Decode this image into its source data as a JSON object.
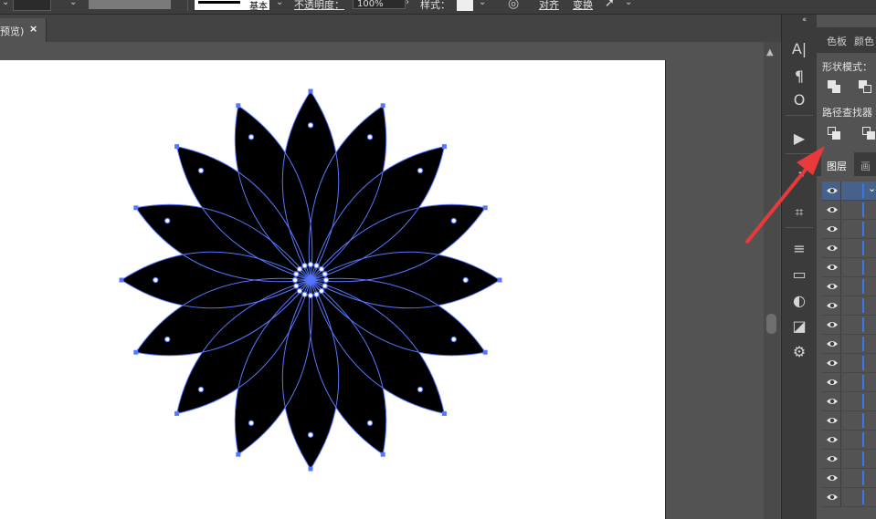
{
  "control_bar": {
    "basic_label": "基本",
    "opacity_label": "不透明度：",
    "opacity_value": "100%",
    "style_label": "样式：",
    "align_label": "对齐",
    "transform_label": "变换"
  },
  "document_tab": {
    "title": "预览)",
    "close_glyph": "×"
  },
  "dock": {
    "collapse_glyph": "‹‹",
    "tools": [
      {
        "name": "character-icon",
        "glyph": "A|"
      },
      {
        "name": "paragraph-icon",
        "glyph": "¶"
      },
      {
        "name": "opentype-icon",
        "glyph": "O"
      },
      {
        "name": "actions-play-icon",
        "glyph": "▶"
      },
      {
        "name": "export-icon",
        "glyph": "↗"
      },
      {
        "name": "artboards-icon",
        "glyph": "⌗"
      },
      {
        "name": "stroke-icon",
        "glyph": "≡"
      },
      {
        "name": "gradient-icon",
        "glyph": "▭"
      },
      {
        "name": "transparency-icon",
        "glyph": "◐"
      },
      {
        "name": "symbols-icon",
        "glyph": "◪"
      },
      {
        "name": "graphic-styles-icon",
        "glyph": "⚙"
      }
    ]
  },
  "panel": {
    "tabs": [
      "色板",
      "颜色"
    ],
    "shape_modes_label": "形状模式：",
    "pathfinder_label": "路径查找器",
    "layers_tab": "图层",
    "layers_tab2": "画",
    "layer_toggle": "⌄",
    "layer_rows": 17,
    "selection_color": "#46618a",
    "layer_color": "#3b78e7"
  },
  "annotation": {
    "arrow_color": "#e83a3a"
  },
  "artwork": {
    "fill": "#000000",
    "outline_color": "#5577ff",
    "petal_count": 16
  }
}
